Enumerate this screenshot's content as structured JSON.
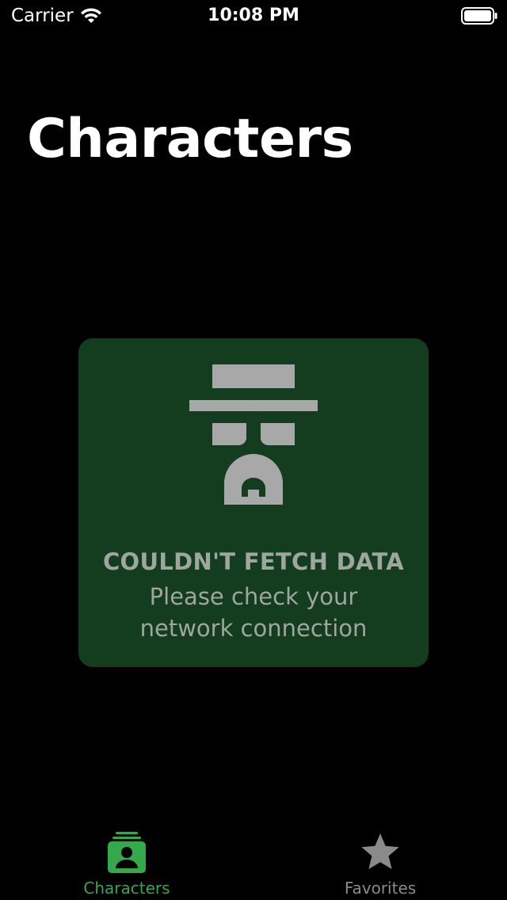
{
  "status_bar": {
    "carrier": "Carrier",
    "time": "10:08 PM"
  },
  "header": {
    "title": "Characters"
  },
  "error_card": {
    "icon": "heisenberg-icon",
    "title": "COULDN'T FETCH DATA",
    "message": "Please check your network connection"
  },
  "tab_bar": {
    "tabs": [
      {
        "label": "Characters",
        "icon": "characters-icon",
        "selected": true
      },
      {
        "label": "Favorites",
        "icon": "star-icon",
        "selected": false
      }
    ]
  },
  "colors": {
    "background": "#000000",
    "card_background": "#133d1e",
    "card_text": "#9ea79f",
    "icon_gray": "#a8a8a8",
    "accent_green": "#34a84a",
    "inactive_gray": "#8a8a8a"
  }
}
